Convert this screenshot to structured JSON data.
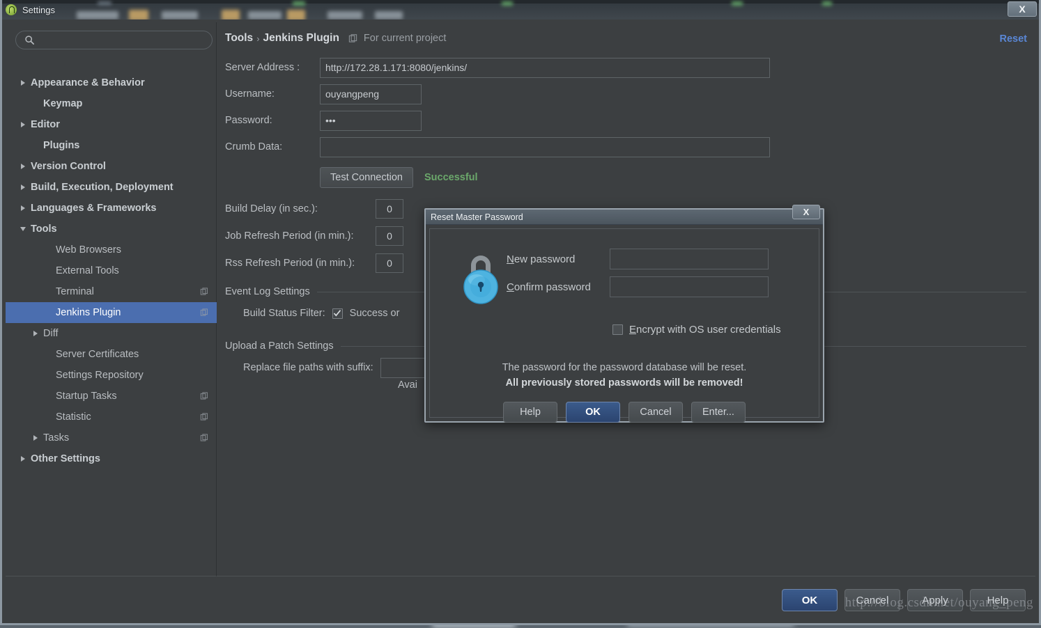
{
  "window": {
    "title": "Settings",
    "app_icon": "android-studio-icon",
    "close_label": "X"
  },
  "sidebar": {
    "search": {
      "value": "",
      "placeholder": "",
      "icon": "search-icon"
    },
    "items": [
      {
        "label": "Appearance & Behavior",
        "arrow": "right",
        "bold": true,
        "indent": 1,
        "badge": false,
        "selected": false
      },
      {
        "label": "Keymap",
        "arrow": "none",
        "bold": true,
        "indent": 2,
        "badge": false,
        "selected": false
      },
      {
        "label": "Editor",
        "arrow": "right",
        "bold": true,
        "indent": 1,
        "badge": false,
        "selected": false
      },
      {
        "label": "Plugins",
        "arrow": "none",
        "bold": true,
        "indent": 2,
        "badge": false,
        "selected": false
      },
      {
        "label": "Version Control",
        "arrow": "right",
        "bold": true,
        "indent": 1,
        "badge": false,
        "selected": false
      },
      {
        "label": "Build, Execution, Deployment",
        "arrow": "right",
        "bold": true,
        "indent": 1,
        "badge": false,
        "selected": false
      },
      {
        "label": "Languages & Frameworks",
        "arrow": "right",
        "bold": true,
        "indent": 1,
        "badge": false,
        "selected": false
      },
      {
        "label": "Tools",
        "arrow": "down",
        "bold": true,
        "indent": 1,
        "badge": false,
        "selected": false
      },
      {
        "label": "Web Browsers",
        "arrow": "none",
        "bold": false,
        "indent": 3,
        "badge": false,
        "selected": false
      },
      {
        "label": "External Tools",
        "arrow": "none",
        "bold": false,
        "indent": 3,
        "badge": false,
        "selected": false
      },
      {
        "label": "Terminal",
        "arrow": "none",
        "bold": false,
        "indent": 3,
        "badge": true,
        "selected": false
      },
      {
        "label": "Jenkins Plugin",
        "arrow": "none",
        "bold": false,
        "indent": 3,
        "badge": true,
        "selected": true
      },
      {
        "label": "Diff",
        "arrow": "right",
        "bold": false,
        "indent": 2,
        "badge": false,
        "selected": false
      },
      {
        "label": "Server Certificates",
        "arrow": "none",
        "bold": false,
        "indent": 3,
        "badge": false,
        "selected": false
      },
      {
        "label": "Settings Repository",
        "arrow": "none",
        "bold": false,
        "indent": 3,
        "badge": false,
        "selected": false
      },
      {
        "label": "Startup Tasks",
        "arrow": "none",
        "bold": false,
        "indent": 3,
        "badge": true,
        "selected": false
      },
      {
        "label": "Statistic",
        "arrow": "none",
        "bold": false,
        "indent": 3,
        "badge": true,
        "selected": false
      },
      {
        "label": "Tasks",
        "arrow": "right",
        "bold": false,
        "indent": 2,
        "badge": true,
        "selected": false
      },
      {
        "label": "Other Settings",
        "arrow": "right",
        "bold": true,
        "indent": 1,
        "badge": false,
        "selected": false
      }
    ]
  },
  "content": {
    "breadcrumb": {
      "root": "Tools",
      "separator": "›",
      "current": "Jenkins Plugin",
      "scope_badge_icon": "project-scope-icon",
      "scope_text": "For current project"
    },
    "reset_link": "Reset",
    "fields": {
      "server_address_label": "Server Address :",
      "server_address_value": "http://172.28.1.171:8080/jenkins/",
      "username_label": "Username:",
      "username_value": "ouyangpeng",
      "password_label": "Password:",
      "password_value": "•••",
      "crumb_label": "Crumb Data:",
      "crumb_value": "",
      "test_connection_label": "Test Connection",
      "test_status": "Successful",
      "test_status_color": "#6ba86b"
    },
    "spinners": [
      {
        "label": "Build Delay (in sec.):",
        "value": "0"
      },
      {
        "label": "Job Refresh Period (in min.):",
        "value": "0"
      },
      {
        "label": "Rss Refresh Period (in min.):",
        "value": "0"
      }
    ],
    "event_log": {
      "section_title": "Event Log Settings",
      "filter_label": "Build Status Filter:",
      "filter_option": "Success or",
      "filter_checked": true
    },
    "upload_patch": {
      "section_title": "Upload a Patch Settings",
      "suffix_label": "Replace file paths with suffix:",
      "suffix_value": "",
      "available_note": "Avai"
    }
  },
  "footer": {
    "buttons": [
      {
        "label": "OK",
        "primary": true
      },
      {
        "label": "Cancel",
        "primary": false
      },
      {
        "label": "Apply",
        "primary": false
      },
      {
        "label": "Help",
        "primary": false
      }
    ],
    "watermark": "http://blog.csdn.net/ouyang_peng"
  },
  "modal": {
    "title": "Reset Master Password",
    "close_label": "X",
    "icon": "padlock-icon",
    "new_password_label": "New password",
    "new_password_accel": "N",
    "new_password_value": "",
    "confirm_password_label": "Confirm password",
    "confirm_password_accel": "C",
    "confirm_password_value": "",
    "encrypt_label": "Encrypt with OS user credentials",
    "encrypt_accel": "E",
    "encrypt_checked": false,
    "message_line1": "The password for the password database will be reset.",
    "message_line2": "All previously stored passwords will be removed!",
    "buttons": [
      {
        "label": "Help",
        "primary": false
      },
      {
        "label": "OK",
        "primary": true
      },
      {
        "label": "Cancel",
        "primary": false
      },
      {
        "label": "Enter...",
        "primary": false
      }
    ]
  }
}
